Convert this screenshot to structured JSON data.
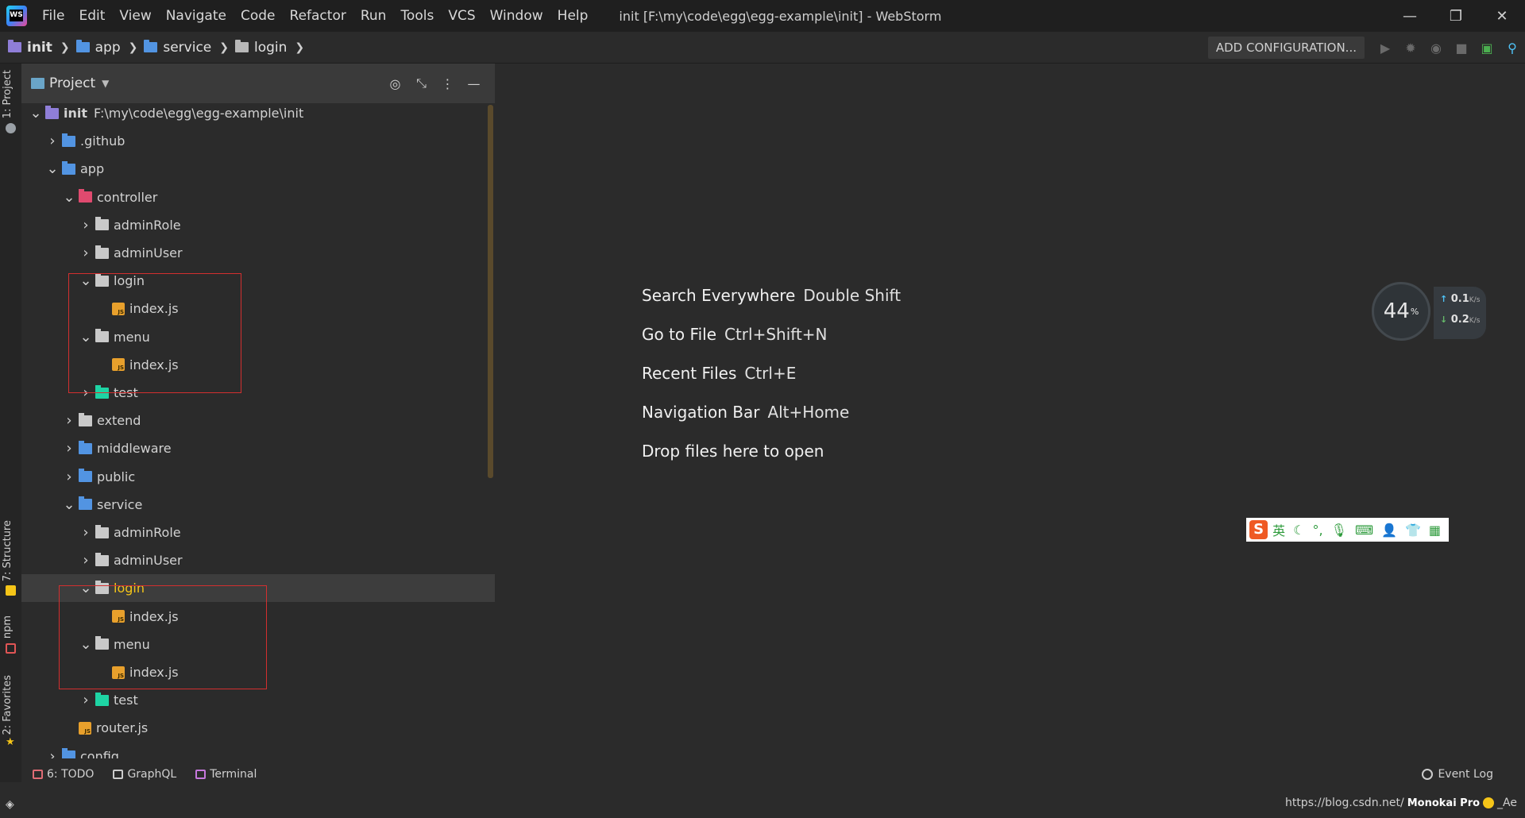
{
  "title_bar": {
    "menu": [
      {
        "label": "File"
      },
      {
        "label": "Edit"
      },
      {
        "label": "View"
      },
      {
        "label": "Navigate"
      },
      {
        "label": "Code"
      },
      {
        "label": "Refactor"
      },
      {
        "label": "Run"
      },
      {
        "label": "Tools"
      },
      {
        "label": "VCS"
      },
      {
        "label": "Window"
      },
      {
        "label": "Help"
      }
    ],
    "window_title": "init [F:\\my\\code\\egg\\egg-example\\init] - WebStorm",
    "controls": {
      "minimize": "—",
      "restore": "❐",
      "close": "✕"
    }
  },
  "breadcrumb": [
    "init",
    "app",
    "service",
    "login"
  ],
  "toolbar": {
    "add_config": "ADD CONFIGURATION...",
    "icons": [
      "run-icon",
      "debug-icon",
      "coverage-icon",
      "stop-icon",
      "terminal-icon",
      "search-icon"
    ]
  },
  "left_strip": {
    "project": "1: Project",
    "structure": "7: Structure",
    "npm": "npm",
    "favorites": "2: Favorites"
  },
  "panel": {
    "title": "Project"
  },
  "tree": [
    {
      "label": "init",
      "path": "F:\\my\\code\\egg\\egg-example\\init",
      "arrow": "v",
      "icon": "folder-purple",
      "depth": 0
    },
    {
      "label": ".github",
      "arrow": ">",
      "icon": "folder-blue",
      "depth": 1
    },
    {
      "label": "app",
      "arrow": "v",
      "icon": "folder-blue",
      "depth": 1
    },
    {
      "label": "controller",
      "arrow": "v",
      "icon": "folder-red",
      "depth": 2
    },
    {
      "label": "adminRole",
      "arrow": ">",
      "icon": "folder",
      "depth": 3
    },
    {
      "label": "adminUser",
      "arrow": ">",
      "icon": "folder",
      "depth": 3
    },
    {
      "label": "login",
      "arrow": "v",
      "icon": "folder",
      "depth": 3
    },
    {
      "label": "index.js",
      "arrow": "",
      "icon": "js",
      "depth": 4
    },
    {
      "label": "menu",
      "arrow": "v",
      "icon": "folder",
      "depth": 3
    },
    {
      "label": "index.js",
      "arrow": "",
      "icon": "js",
      "depth": 4
    },
    {
      "label": "test",
      "arrow": ">",
      "icon": "folder-teal",
      "depth": 3
    },
    {
      "label": "extend",
      "arrow": ">",
      "icon": "folder",
      "depth": 2
    },
    {
      "label": "middleware",
      "arrow": ">",
      "icon": "folder-blue",
      "depth": 2
    },
    {
      "label": "public",
      "arrow": ">",
      "icon": "folder-blue",
      "depth": 2
    },
    {
      "label": "service",
      "arrow": "v",
      "icon": "folder-blue",
      "depth": 2
    },
    {
      "label": "adminRole",
      "arrow": ">",
      "icon": "folder",
      "depth": 3
    },
    {
      "label": "adminUser",
      "arrow": ">",
      "icon": "folder",
      "depth": 3
    },
    {
      "label": "login",
      "arrow": "v",
      "icon": "folder",
      "depth": 3,
      "selected": true
    },
    {
      "label": "index.js",
      "arrow": "",
      "icon": "js",
      "depth": 4
    },
    {
      "label": "menu",
      "arrow": "v",
      "icon": "folder",
      "depth": 3
    },
    {
      "label": "index.js",
      "arrow": "",
      "icon": "js",
      "depth": 4
    },
    {
      "label": "test",
      "arrow": ">",
      "icon": "folder-teal",
      "depth": 3
    },
    {
      "label": "router.js",
      "arrow": "",
      "icon": "js",
      "depth": 2
    },
    {
      "label": "config",
      "arrow": ">",
      "icon": "folder-blue",
      "depth": 1
    }
  ],
  "hints": [
    {
      "action": "Search Everywhere",
      "key": "Double Shift"
    },
    {
      "action": "Go to File",
      "key": "Ctrl+Shift+N"
    },
    {
      "action": "Recent Files",
      "key": "Ctrl+E"
    },
    {
      "action": "Navigation Bar",
      "key": "Alt+Home"
    },
    {
      "action": "Drop files here to open",
      "key": ""
    }
  ],
  "net_widget": {
    "percent": "44",
    "percent_unit": "%",
    "up": "0.1",
    "down": "0.2",
    "unit": "K/s"
  },
  "ime": {
    "logo": "S",
    "mode": "英"
  },
  "bottom_tabs": [
    {
      "label": "6: TODO",
      "color": "#e06c75"
    },
    {
      "label": "GraphQL",
      "color": "#cccccc"
    },
    {
      "label": "Terminal",
      "color": "#c678dd"
    }
  ],
  "event_log": "Event Log",
  "status": {
    "url": "https://blog.csdn.net/",
    "theme": "Monokai Pro",
    "suffix": "_Ae"
  },
  "colors": {
    "accent": "#f5c518",
    "highlight_box": "#d32f2f",
    "background": "#2b2b2b"
  }
}
